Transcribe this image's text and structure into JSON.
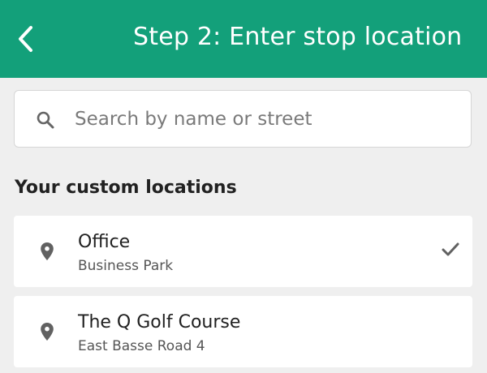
{
  "header": {
    "title": "Step 2: Enter stop location",
    "back_icon": "chevron-left-icon",
    "color": "#13a07a"
  },
  "search": {
    "placeholder": "Search by name or street",
    "value": "",
    "icon": "search-icon"
  },
  "custom_locations": {
    "heading": "Your custom locations",
    "items": [
      {
        "title": "Office",
        "subtitle": "Business Park",
        "icon": "map-pin-icon",
        "selected": true
      },
      {
        "title": "The Q Golf Course",
        "subtitle": "East Basse Road 4",
        "icon": "map-pin-icon",
        "selected": false
      }
    ]
  }
}
